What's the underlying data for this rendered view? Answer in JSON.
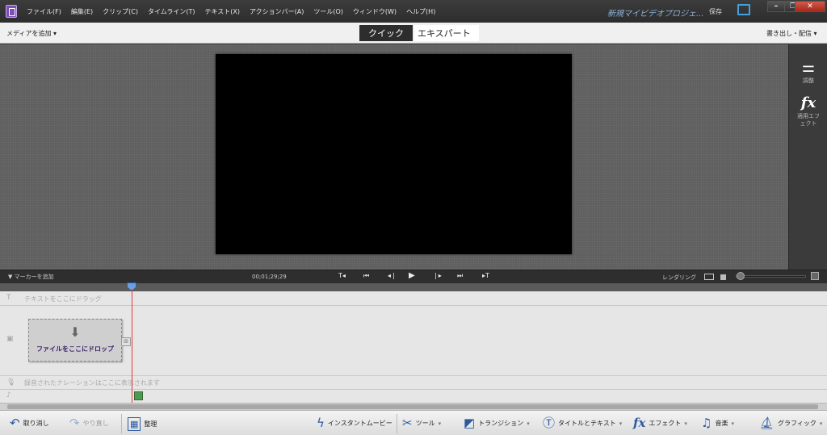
{
  "menu": {
    "items": [
      "ファイル(F)",
      "編集(E)",
      "クリップ(C)",
      "タイムライン(T)",
      "テキスト(X)",
      "アクションバー(A)",
      "ツール(O)",
      "ウィンドウ(W)",
      "ヘルプ(H)"
    ],
    "project_title": "新規マイビデオプロジェ...",
    "save_label": "保存"
  },
  "window_controls": {
    "minimize": "–",
    "restore": "❐",
    "close": "✕"
  },
  "modebar": {
    "add_media": "メディアを追加 ▾",
    "quick": "クイック",
    "expert": "エキスパート",
    "export_share": "書き出し・配信 ▾"
  },
  "right_panel": {
    "adjust_label": "調整",
    "applied_effects_label": "適用エフェクト"
  },
  "transport": {
    "add_marker": "▼  マーカーを追加",
    "timecode": "00;01;29;29",
    "rendering": "レンダリング"
  },
  "timeline": {
    "text_track_hint": "テキストをここにドラッグ",
    "drop_label": "ファイルをここにドロップ",
    "narration_hint": "録音されたナレーションはここに表示されます"
  },
  "actionbar": {
    "undo": "取り消し",
    "redo": "やり直し",
    "organize": "整理",
    "instant_movie": "インスタントムービー",
    "tools": "ツール",
    "transitions": "トランジション",
    "titles_text": "タイトルとテキスト",
    "effects": "エフェクト",
    "music": "音楽",
    "graphics": "グラフィック"
  },
  "colors": {
    "accent_blue": "#2c5aa0",
    "playhead": "#e23a3a",
    "drop_label": "#3a1f66"
  }
}
